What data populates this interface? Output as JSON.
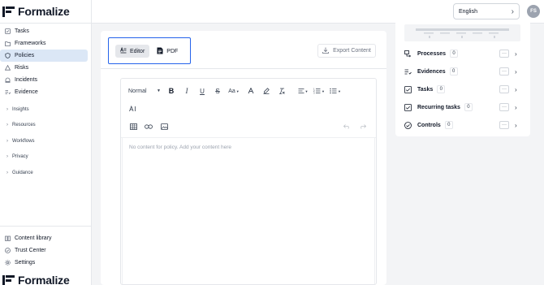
{
  "brand": {
    "name": "Formalize"
  },
  "sidebar": {
    "items": [
      {
        "label": "Tasks",
        "icon": "tasks-icon"
      },
      {
        "label": "Frameworks",
        "icon": "frameworks-icon"
      },
      {
        "label": "Policies",
        "icon": "policies-shield-icon",
        "active": true
      },
      {
        "label": "Risks",
        "icon": "risks-icon"
      },
      {
        "label": "Incidents",
        "icon": "incidents-icon"
      },
      {
        "label": "Evidence",
        "icon": "evidence-icon"
      }
    ],
    "groups": [
      {
        "label": "Insights"
      },
      {
        "label": "Resources"
      },
      {
        "label": "Workflows"
      },
      {
        "label": "Privacy"
      },
      {
        "label": "Guidance"
      }
    ],
    "bottom": [
      {
        "label": "Content library",
        "icon": "book-icon"
      },
      {
        "label": "Trust Center",
        "icon": "check-circle-icon"
      },
      {
        "label": "Settings",
        "icon": "gear-icon"
      }
    ]
  },
  "topbar": {
    "language": "English",
    "avatar_initials": "FS"
  },
  "toggle": {
    "editor_label": "Editor",
    "pdf_label": "PDF",
    "active": "Editor"
  },
  "export": {
    "label": "Export Content"
  },
  "toolbar": {
    "style_select": "Normal",
    "buttons": [
      "bold",
      "italic",
      "underline",
      "strikethrough",
      "font-size",
      "text-color",
      "highlight",
      "clear-format",
      "align",
      "ordered-list",
      "bullet-list",
      "ai",
      "table",
      "link",
      "image",
      "undo",
      "redo"
    ]
  },
  "editor": {
    "placeholder": "No content for policy. Add your content here"
  },
  "related": [
    {
      "label": "Processes",
      "count": "0",
      "icon": "processes-icon"
    },
    {
      "label": "Evidences",
      "count": "0",
      "icon": "evidences-icon"
    },
    {
      "label": "Tasks",
      "count": "0",
      "icon": "tasks-check-icon"
    },
    {
      "label": "Recurring tasks",
      "count": "0",
      "icon": "recurring-tasks-icon"
    },
    {
      "label": "Controls",
      "count": "0",
      "icon": "controls-icon"
    }
  ],
  "colors": {
    "accent": "#2563eb",
    "active_nav": "#dbe7f6",
    "page_bg": "#f3f4f6"
  }
}
